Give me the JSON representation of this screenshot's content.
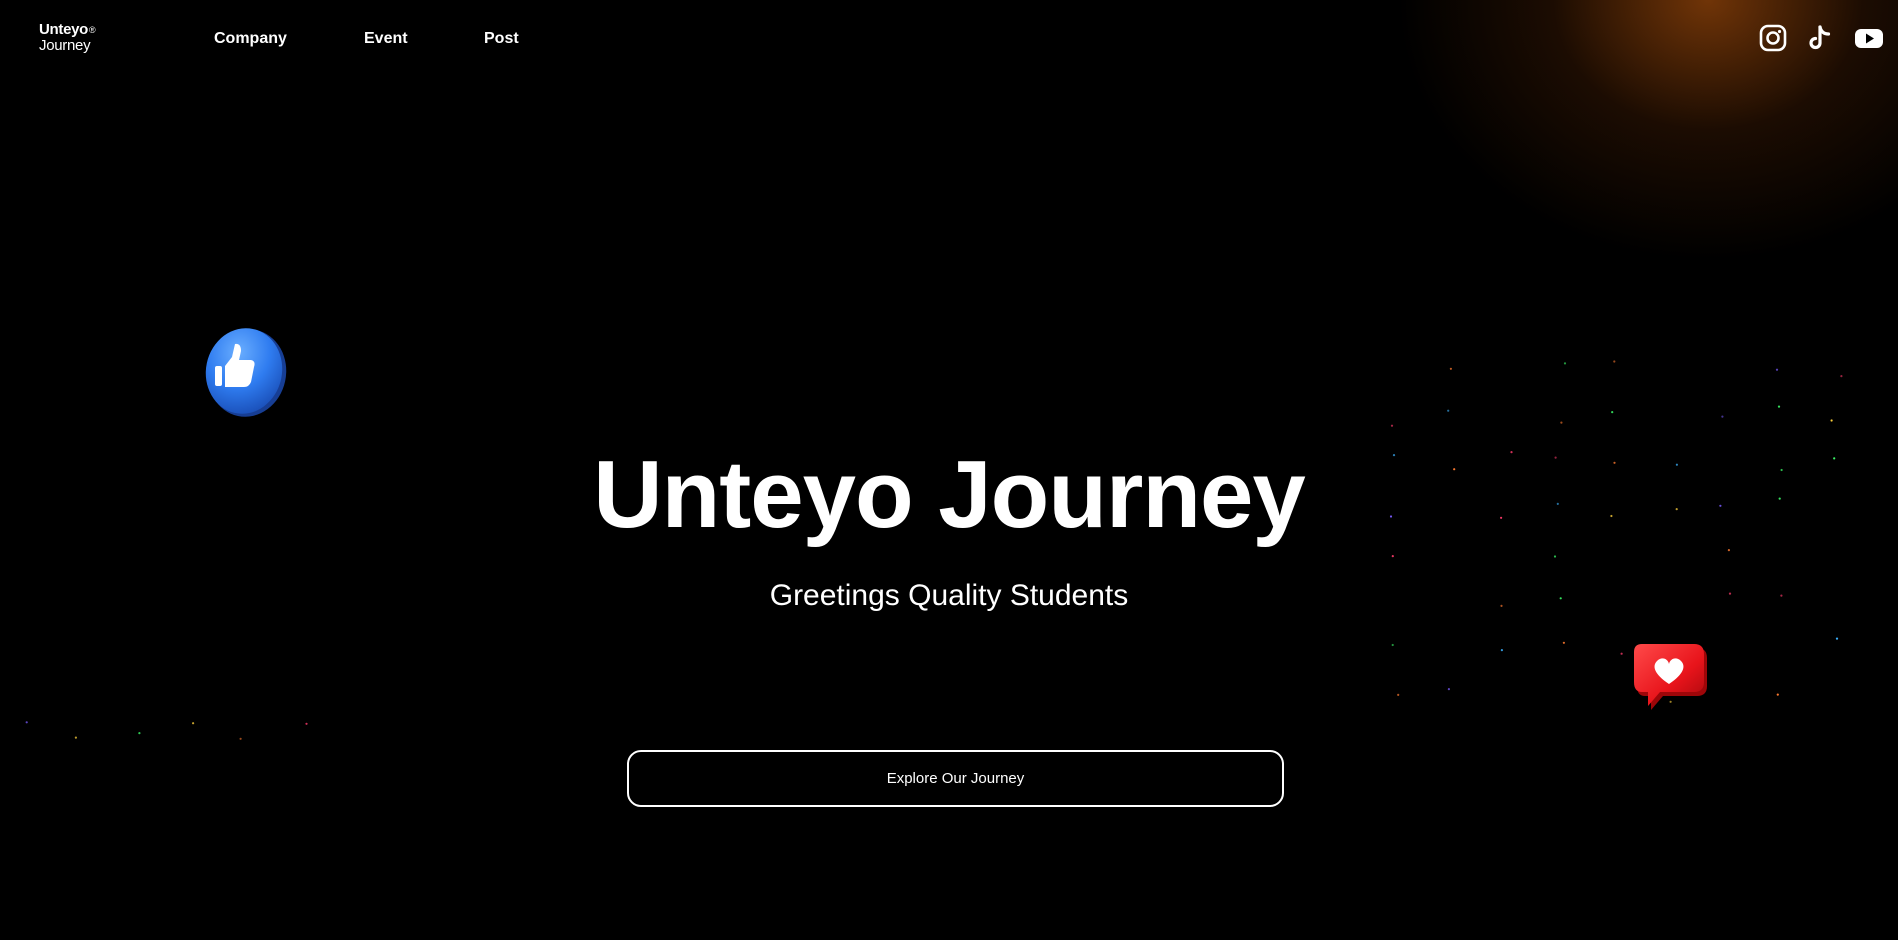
{
  "brand": {
    "line1": "Unteyo",
    "mark": "®",
    "line2": "Journey"
  },
  "nav": {
    "items": [
      "Company",
      "Event",
      "Post"
    ]
  },
  "social": {
    "icons": [
      "instagram-icon",
      "tiktok-icon",
      "youtube-icon"
    ]
  },
  "hero": {
    "title": "Unteyo Journey",
    "subtitle": "Greetings Quality Students",
    "cta_label": "Explore Our Journey"
  },
  "decor": {
    "like_icon": "thumbs-up-icon",
    "heart_icon": "heart-icon"
  },
  "colors": {
    "background": "#000000",
    "text": "#ffffff",
    "like_blue": "#2f7cf0",
    "heart_red": "#e8141b",
    "glow_orange": "#8a4510"
  }
}
